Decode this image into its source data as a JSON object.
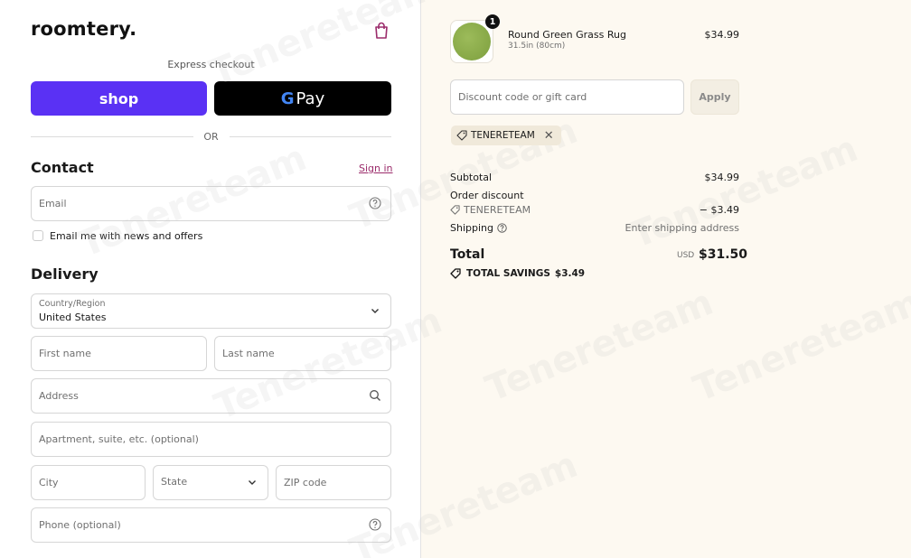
{
  "brand": {
    "logo": "roomtery."
  },
  "express": {
    "label": "Express checkout",
    "shop_label": "shop",
    "gpay_g": "G",
    "gpay_label": "Pay"
  },
  "divider": {
    "or": "OR"
  },
  "contact": {
    "title": "Contact",
    "sign_in": "Sign in",
    "email_placeholder": "Email",
    "newsletter_label": "Email me with news and offers"
  },
  "delivery": {
    "title": "Delivery",
    "country_label": "Country/Region",
    "country_value": "United States",
    "first_name": "First name",
    "last_name": "Last name",
    "address": "Address",
    "apartment": "Apartment, suite, etc. (optional)",
    "city": "City",
    "state": "State",
    "zip": "ZIP code",
    "phone": "Phone (optional)"
  },
  "cart": {
    "item": {
      "quantity": "1",
      "name": "Round Green Grass Rug",
      "variant": "31.5in (80cm)",
      "price": "$34.99"
    },
    "discount_placeholder": "Discount code or gift card",
    "apply_label": "Apply",
    "applied_code": "TENERETEAM"
  },
  "summary": {
    "subtotal_label": "Subtotal",
    "subtotal_value": "$34.99",
    "order_discount_label": "Order discount",
    "discount_code": "TENERETEAM",
    "discount_value": "− $3.49",
    "shipping_label": "Shipping",
    "shipping_value": "Enter shipping address",
    "total_label": "Total",
    "currency": "USD",
    "total_value": "$31.50",
    "savings_label": "TOTAL SAVINGS",
    "savings_value": "$3.49"
  },
  "watermark": "Tenereteam",
  "colors": {
    "shop_purple": "#5a31f4",
    "accent_link": "#9b2c6b",
    "right_bg": "#fdf9f1"
  }
}
